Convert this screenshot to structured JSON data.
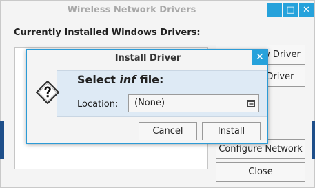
{
  "main_window": {
    "title": "Wireless Network Drivers",
    "section_label": "Currently Installed Windows Drivers:",
    "buttons": {
      "install_new_driver": "Install New Driver",
      "remove_driver": "Remove Driver",
      "configure_network": "Configure Network",
      "close": "Close"
    },
    "window_controls": {
      "minimize": "–",
      "maximize": "□",
      "close": "✕"
    }
  },
  "dialog": {
    "title": "Install Driver",
    "heading_prefix": "Select ",
    "heading_em": "inf",
    "heading_suffix": " file:",
    "location_label": "Location:",
    "location_value": "(None)",
    "cancel_label": "Cancel",
    "install_label": "Install",
    "close_glyph": "✕"
  },
  "icons": {
    "question": "question-icon",
    "browse": "folder-browse-icon"
  }
}
